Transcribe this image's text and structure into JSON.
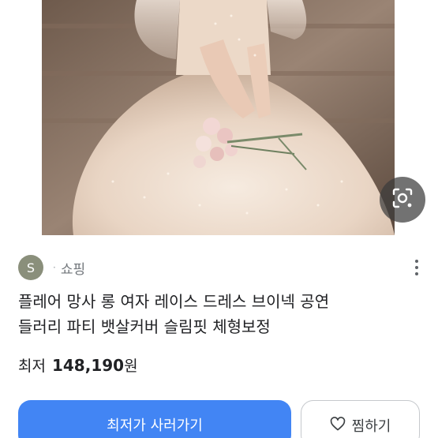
{
  "product": {
    "title_line1": "플레어 망사 롱 여자 레이스 드레스 브이넥 공연",
    "title_line2": "들러리 파티 뱃살커버 슬림핏 체형보정",
    "image_alt": "wedding-dress-photo"
  },
  "seller": {
    "avatar_letter": "S",
    "separator": "·",
    "name": "쇼핑"
  },
  "price": {
    "label": "최저",
    "value": "148,190",
    "unit": "원"
  },
  "actions": {
    "buy_label": "최저가 사러가기",
    "wish_label": "찜하기"
  },
  "icons": {
    "lens": "lens-search-icon",
    "more": "more-vertical-icon",
    "heart": "heart-icon"
  },
  "colors": {
    "buy_button": "#4285f4",
    "avatar": "#8a8f7b"
  }
}
